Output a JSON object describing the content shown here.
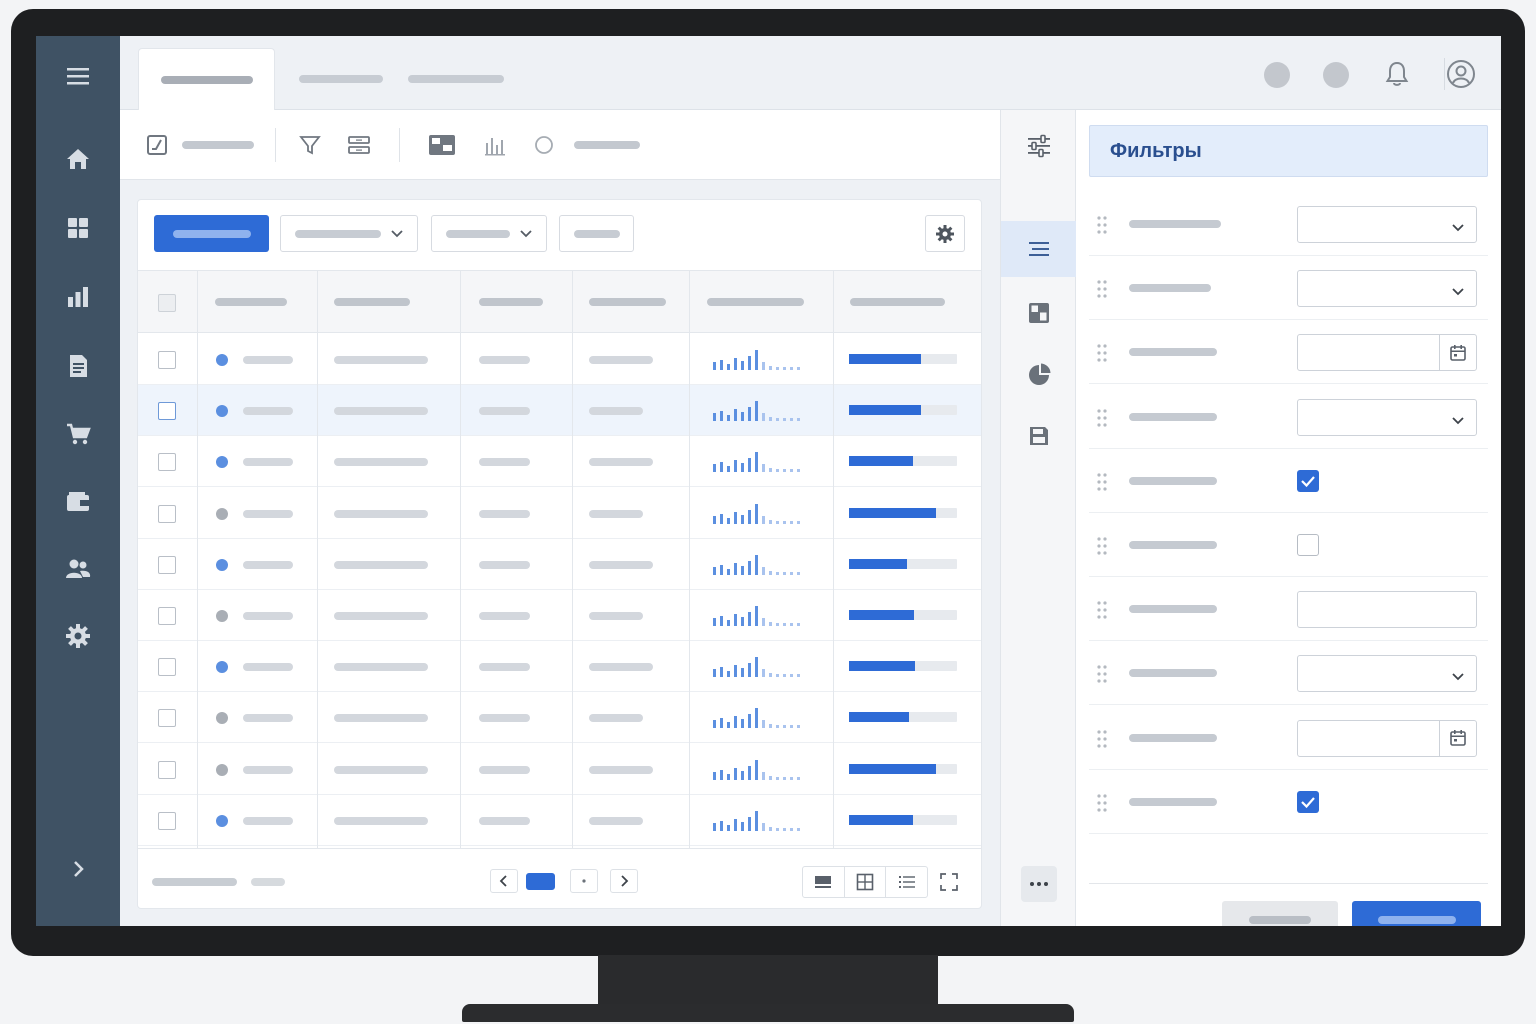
{
  "filter_panel": {
    "title": "Фильтры"
  },
  "colors": {
    "accent": "#2e6bd6",
    "sidebar": "#3f5264",
    "status_blue": "#5b8fe0",
    "status_gray": "#a9aeb5"
  },
  "sidebar_icons": [
    "menu-icon",
    "home-icon",
    "dashboard-icon",
    "bar-chart-icon",
    "document-icon",
    "cart-icon",
    "wallet-icon",
    "users-icon",
    "settings-icon",
    "chevron-right-icon"
  ],
  "table": {
    "rows": [
      {
        "status": "blue",
        "progress": 0.67,
        "selected": false,
        "highlighted": false
      },
      {
        "status": "blue",
        "progress": 0.67,
        "selected": false,
        "highlighted": true
      },
      {
        "status": "blue",
        "progress": 0.59,
        "selected": false,
        "highlighted": false
      },
      {
        "status": "gray",
        "progress": 0.81,
        "selected": false,
        "highlighted": false
      },
      {
        "status": "blue",
        "progress": 0.54,
        "selected": false,
        "highlighted": false
      },
      {
        "status": "gray",
        "progress": 0.6,
        "selected": false,
        "highlighted": false
      },
      {
        "status": "blue",
        "progress": 0.61,
        "selected": false,
        "highlighted": false
      },
      {
        "status": "gray",
        "progress": 0.56,
        "selected": false,
        "highlighted": false
      },
      {
        "status": "gray",
        "progress": 0.81,
        "selected": false,
        "highlighted": false
      },
      {
        "status": "blue",
        "progress": 0.59,
        "selected": false,
        "highlighted": false
      }
    ]
  },
  "filters": [
    {
      "type": "select"
    },
    {
      "type": "select"
    },
    {
      "type": "date"
    },
    {
      "type": "select"
    },
    {
      "type": "checkbox",
      "checked": true
    },
    {
      "type": "checkbox",
      "checked": false
    },
    {
      "type": "text"
    },
    {
      "type": "select"
    },
    {
      "type": "date"
    },
    {
      "type": "checkbox",
      "checked": true
    }
  ]
}
